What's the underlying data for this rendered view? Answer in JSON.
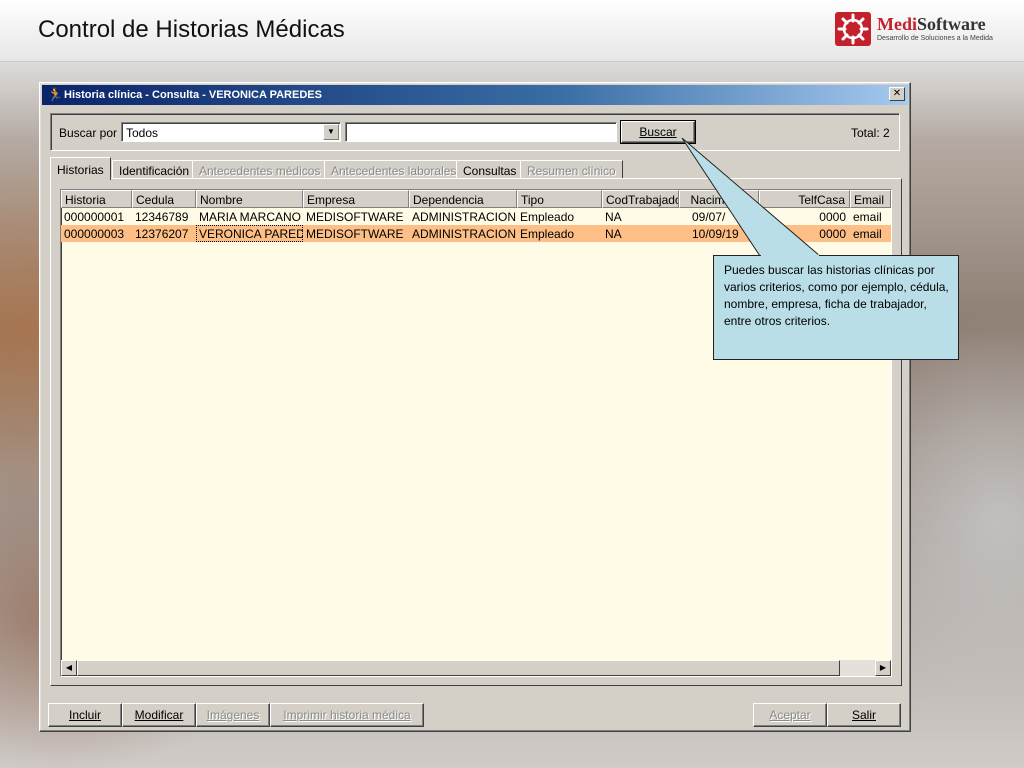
{
  "page": {
    "title": "Control de Historias Médicas"
  },
  "logo": {
    "name_part1": "Medi",
    "name_part2": "Software",
    "tagline": "Desarrollo de Soluciones a la Medida"
  },
  "window": {
    "title": "Historia clínica - Consulta - VERONICA PAREDES",
    "close_glyph": "✕"
  },
  "search": {
    "label": "Buscar por",
    "criteria_value": "Todos",
    "text_value": "",
    "button_label": "Buscar",
    "total_label": "Total: 2"
  },
  "tabs": [
    {
      "label": "Historias",
      "active": true,
      "enabled": true
    },
    {
      "label": "Identificación",
      "active": false,
      "enabled": true
    },
    {
      "label": "Antecedentes médicos",
      "active": false,
      "enabled": false
    },
    {
      "label": "Antecedentes laborales",
      "active": false,
      "enabled": false
    },
    {
      "label": "Consultas",
      "active": false,
      "enabled": true
    },
    {
      "label": "Resumen clínico",
      "active": false,
      "enabled": false
    }
  ],
  "table": {
    "columns": [
      "Historia",
      "Cedula",
      "Nombre",
      "Empresa",
      "Dependencia",
      "Tipo",
      "CodTrabajado",
      "Nacimiento",
      "TelfCasa",
      "Email"
    ],
    "rows": [
      [
        "000000001",
        "12346789",
        "MARIA MARCANO",
        "MEDISOFTWARE",
        "ADMINISTRACION",
        "Empleado",
        "NA",
        "09/07/",
        "0000",
        "email"
      ],
      [
        "000000003",
        "12376207",
        "VERONICA PARED",
        "MEDISOFTWARE",
        "ADMINISTRACION",
        "Empleado",
        "NA",
        "10/09/19",
        "0000",
        "email"
      ]
    ],
    "selected_row": 1
  },
  "buttons": {
    "incluir": "Incluir",
    "modificar": "Modificar",
    "imagenes": "Imágenes",
    "imprimir": "Imprimir historia médica",
    "aceptar": "Aceptar",
    "salir": "Salir"
  },
  "callout": {
    "text": "Puedes buscar las historias clínicas por varios criterios, como por ejemplo, cédula, nombre, empresa, ficha de trabajador, entre otros criterios."
  },
  "colors": {
    "selected_row": "#fdbf86",
    "grid_background": "#fffbe6",
    "callout_background": "#b9dee8",
    "titlebar_start": "#0a246a",
    "brand_red": "#c3212b"
  }
}
